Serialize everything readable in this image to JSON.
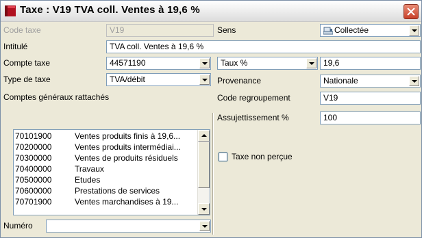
{
  "window": {
    "title": "Taxe : V19 TVA coll. Ventes à 19,6 %"
  },
  "form": {
    "code_taxe_label": "Code taxe",
    "code_taxe_value": "V19",
    "intitule_label": "Intitulé",
    "intitule_value": "TVA coll. Ventes à 19,6 %",
    "compte_taxe_label": "Compte taxe",
    "compte_taxe_value": "44571190",
    "type_taxe_label": "Type de taxe",
    "type_taxe_value": "TVA/débit",
    "comptes_label": "Comptes généraux rattachés",
    "numero_label": "Numéro",
    "numero_value": "",
    "sens_label": "Sens",
    "sens_value": "Collectée",
    "taux_select_value": "Taux %",
    "taux_value": "19,6",
    "provenance_label": "Provenance",
    "provenance_value": "Nationale",
    "code_regroupement_label": "Code regroupement",
    "code_regroupement_value": "V19",
    "assujettissement_label": "Assujettissement %",
    "assujettissement_value": "100",
    "taxe_non_percue_label": "Taxe non perçue",
    "taxe_non_percue_checked": false
  },
  "comptes": [
    {
      "code": "70101900",
      "libelle": "Ventes produits finis à 19,6..."
    },
    {
      "code": "70200000",
      "libelle": "Ventes produits intermédiai..."
    },
    {
      "code": "70300000",
      "libelle": "Ventes de produits résiduels"
    },
    {
      "code": "70400000",
      "libelle": "Travaux"
    },
    {
      "code": "70500000",
      "libelle": "Etudes"
    },
    {
      "code": "70600000",
      "libelle": "Prestations de services"
    },
    {
      "code": "70701900",
      "libelle": "Ventes marchandises à 19..."
    }
  ],
  "icons": {
    "title": "tax-flag-icon",
    "close": "close-icon",
    "sens": "register-icon"
  },
  "colors": {
    "close": "#c8412a",
    "field_border": "#7f9db9",
    "window_bg": "#ece9d8"
  }
}
